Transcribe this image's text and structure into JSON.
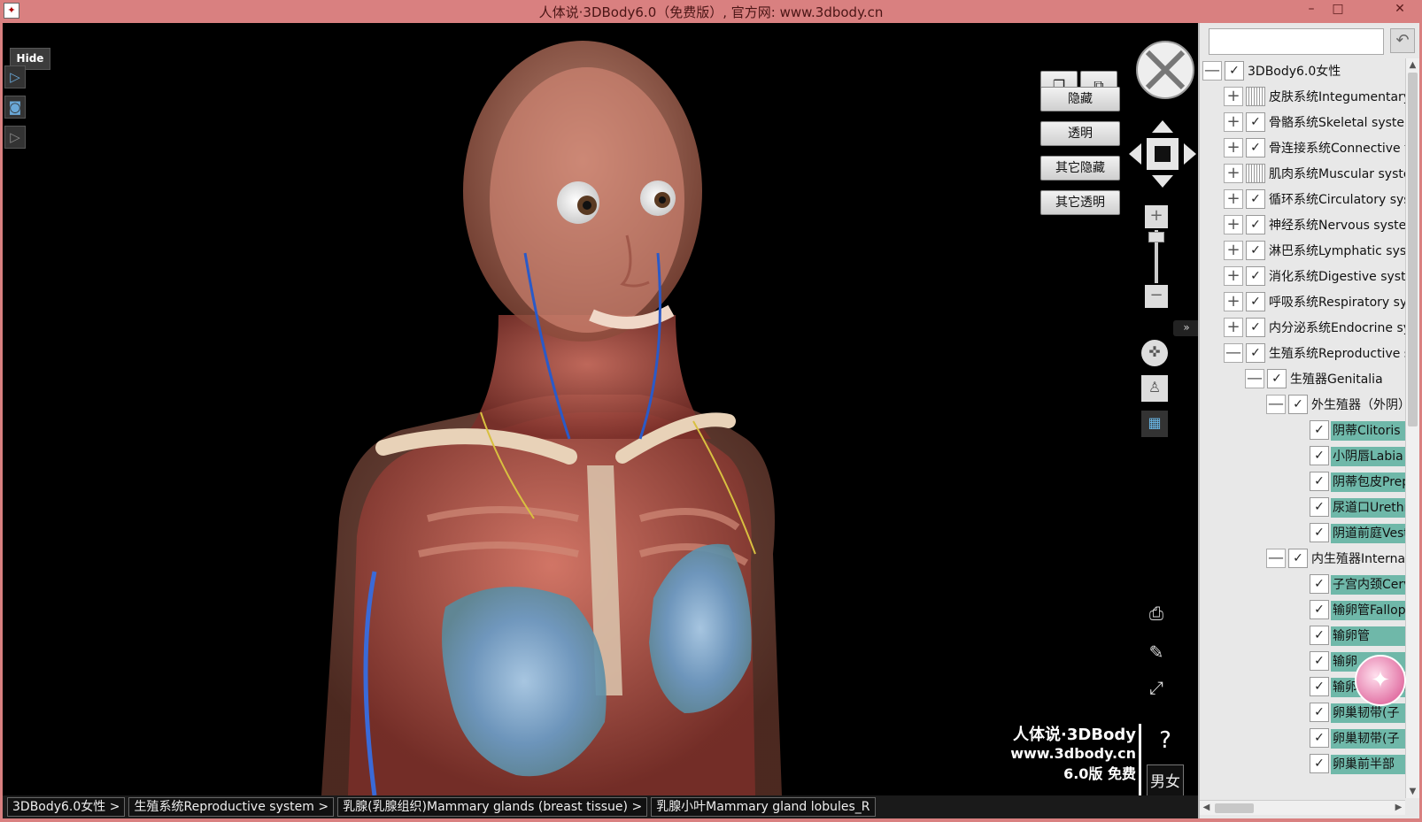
{
  "window": {
    "title": "人体说·3DBody6.0（免费版）, 官方网:  www.3dbody.cn",
    "controls": [
      "–",
      "□",
      "✕"
    ]
  },
  "viewport": {
    "hide_label": "Hide",
    "view_buttons": [
      "隐藏",
      "透明",
      "其它隐藏",
      "其它透明"
    ],
    "zoom_in": "+",
    "zoom_out": "−",
    "zoom_level": 0.9,
    "collapse": "»",
    "help": "?",
    "gender_toggle": "男女",
    "watermark": {
      "line1": "人体说·3DBody",
      "line2": "www.3dbody.cn",
      "line3": "6.0版 免费"
    }
  },
  "breadcrumb": [
    "3DBody6.0女性 >",
    "生殖系统Reproductive system >",
    "乳腺(乳腺组织)Mammary glands (breast tissue) >",
    "乳腺小叶Mammary gland lobules_R"
  ],
  "panel": {
    "search_placeholder": "",
    "back_icon": "back-arrow-icon",
    "tree": [
      {
        "level": 0,
        "expander": "—",
        "state": "checked",
        "label": "3DBody6.0女性",
        "teal": false
      },
      {
        "level": 1,
        "expander": "+",
        "state": "partial",
        "label": "皮肤系统Integumentary system",
        "teal": false
      },
      {
        "level": 1,
        "expander": "+",
        "state": "checked",
        "label": "骨骼系统Skeletal system",
        "teal": false
      },
      {
        "level": 1,
        "expander": "+",
        "state": "checked",
        "label": "骨连接系统Connective tissue",
        "teal": false
      },
      {
        "level": 1,
        "expander": "+",
        "state": "partial",
        "label": "肌肉系统Muscular system",
        "teal": false
      },
      {
        "level": 1,
        "expander": "+",
        "state": "checked",
        "label": "循环系统Circulatory system",
        "teal": false
      },
      {
        "level": 1,
        "expander": "+",
        "state": "checked",
        "label": "神经系统Nervous system",
        "teal": false
      },
      {
        "level": 1,
        "expander": "+",
        "state": "checked",
        "label": "淋巴系统Lymphatic system",
        "teal": false
      },
      {
        "level": 1,
        "expander": "+",
        "state": "checked",
        "label": "消化系统Digestive system",
        "teal": false
      },
      {
        "level": 1,
        "expander": "+",
        "state": "checked",
        "label": "呼吸系统Respiratory system",
        "teal": false
      },
      {
        "level": 1,
        "expander": "+",
        "state": "checked",
        "label": "内分泌系统Endocrine system",
        "teal": false
      },
      {
        "level": 1,
        "expander": "—",
        "state": "checked",
        "label": "生殖系统Reproductive system",
        "teal": false
      },
      {
        "level": 2,
        "expander": "—",
        "state": "checked",
        "label": "生殖器Genitalia",
        "teal": false
      },
      {
        "level": 3,
        "expander": "—",
        "state": "checked",
        "label": "外生殖器（外阴）",
        "teal": false
      },
      {
        "level": 4,
        "expander": "",
        "state": "checked",
        "label": "阴蒂Clitoris",
        "teal": true
      },
      {
        "level": 4,
        "expander": "",
        "state": "checked",
        "label": "小阴唇Labia",
        "teal": true
      },
      {
        "level": 4,
        "expander": "",
        "state": "checked",
        "label": "阴蒂包皮Prepuce",
        "teal": true
      },
      {
        "level": 4,
        "expander": "",
        "state": "checked",
        "label": "尿道口Urethra",
        "teal": true
      },
      {
        "level": 4,
        "expander": "",
        "state": "checked",
        "label": "阴道前庭Vestibule",
        "teal": true
      },
      {
        "level": 3,
        "expander": "—",
        "state": "checked",
        "label": "内生殖器Internal",
        "teal": false
      },
      {
        "level": 4,
        "expander": "",
        "state": "checked",
        "label": "子宫内颈Cervix",
        "teal": true
      },
      {
        "level": 4,
        "expander": "",
        "state": "checked",
        "label": "输卵管Fallopian",
        "teal": true
      },
      {
        "level": 4,
        "expander": "",
        "state": "checked",
        "label": "输卵管",
        "teal": true
      },
      {
        "level": 4,
        "expander": "",
        "state": "checked",
        "label": "输卵",
        "teal": true
      },
      {
        "level": 4,
        "expander": "",
        "state": "checked",
        "label": "输卵管伞Fimbriae",
        "teal": true
      },
      {
        "level": 4,
        "expander": "",
        "state": "checked",
        "label": "卵巢韧带(子",
        "teal": true
      },
      {
        "level": 4,
        "expander": "",
        "state": "checked",
        "label": "卵巢韧带(子",
        "teal": true
      },
      {
        "level": 4,
        "expander": "",
        "state": "checked",
        "label": "卵巢前半部",
        "teal": true
      }
    ]
  },
  "colors": {
    "titlebar": "#d98080",
    "highlight": "#6fb8a9",
    "breast_tissue": "#7ab0d8"
  }
}
